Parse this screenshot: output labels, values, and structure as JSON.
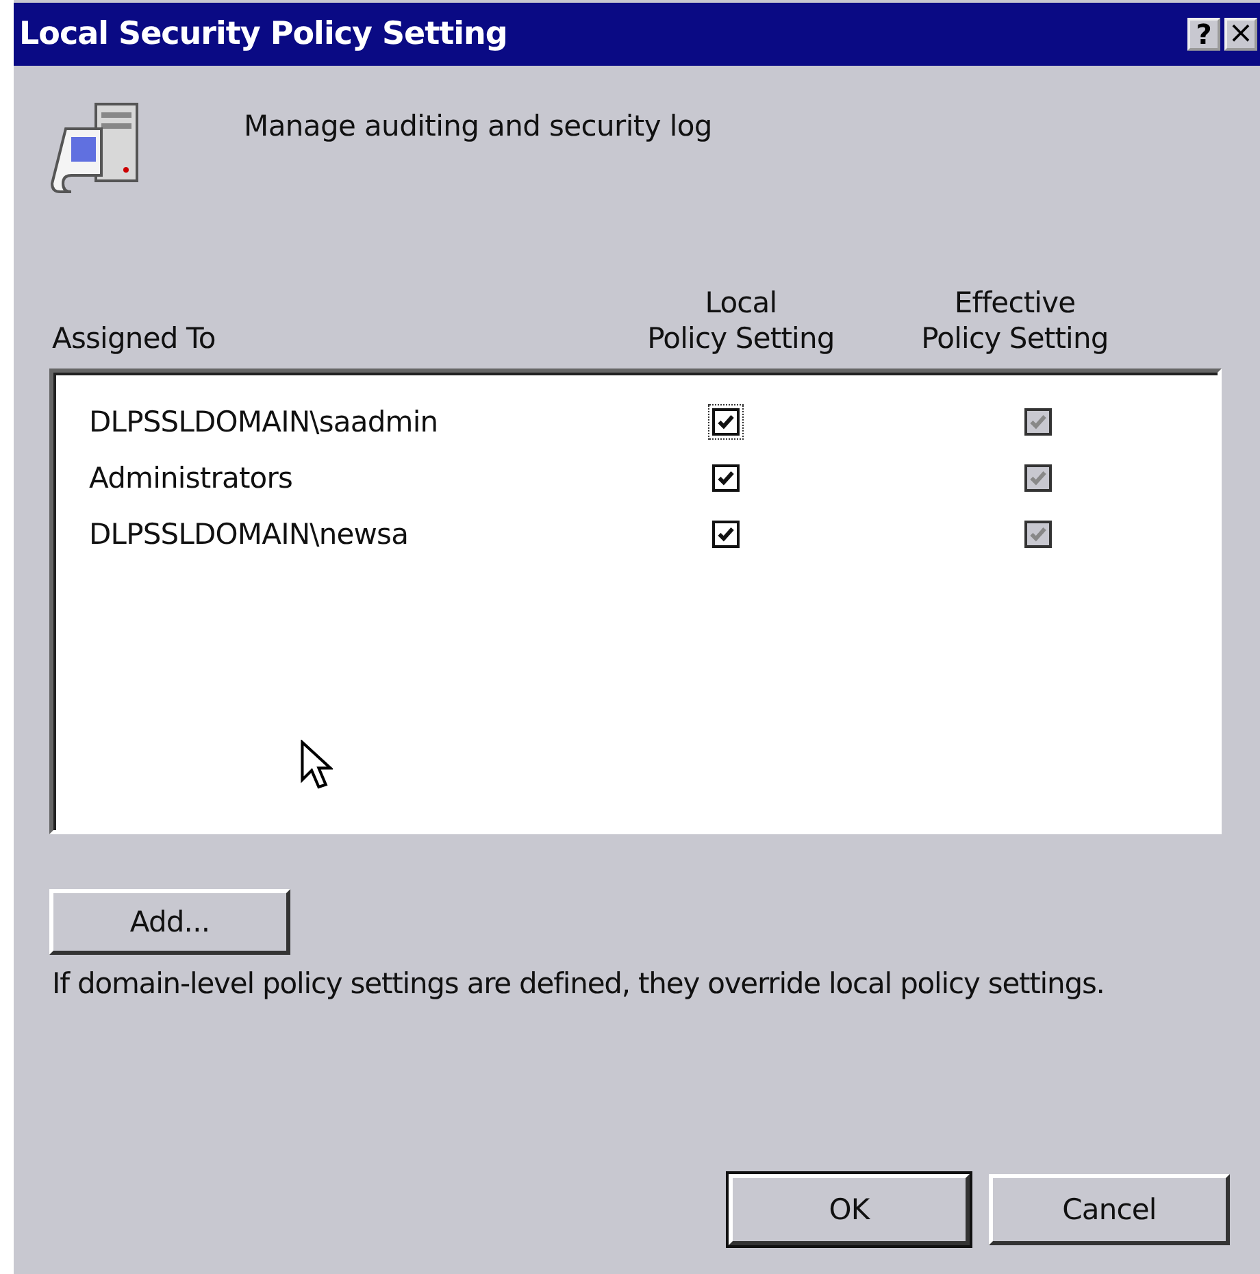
{
  "window": {
    "title": "Local Security Policy Setting",
    "title_buttons": [
      {
        "kind": "help",
        "label": "?"
      },
      {
        "kind": "close",
        "label": "×"
      }
    ]
  },
  "description": "Manage auditing and security log",
  "columns": [
    "Assigned To",
    "Local\nPolicy Setting",
    "Effective\nPolicy Setting"
  ],
  "rows": [
    {
      "name": "DLPSSLDOMAIN\\saadmin",
      "local": {
        "checked": true,
        "focused": true
      },
      "effective": {
        "checked": true,
        "disabled": true
      }
    },
    {
      "name": "Administrators",
      "local": {
        "checked": true,
        "focused": false
      },
      "effective": {
        "checked": true,
        "disabled": true
      }
    },
    {
      "name": "DLPSSLDOMAIN\\newsa",
      "local": {
        "checked": true,
        "focused": false
      },
      "effective": {
        "checked": true,
        "disabled": true
      }
    }
  ],
  "add_button": "Add...",
  "note": "If domain-level policy settings are defined, they override local policy settings.",
  "buttons": [
    {
      "label": "OK",
      "default": true
    },
    {
      "label": "Cancel",
      "default": false
    }
  ]
}
